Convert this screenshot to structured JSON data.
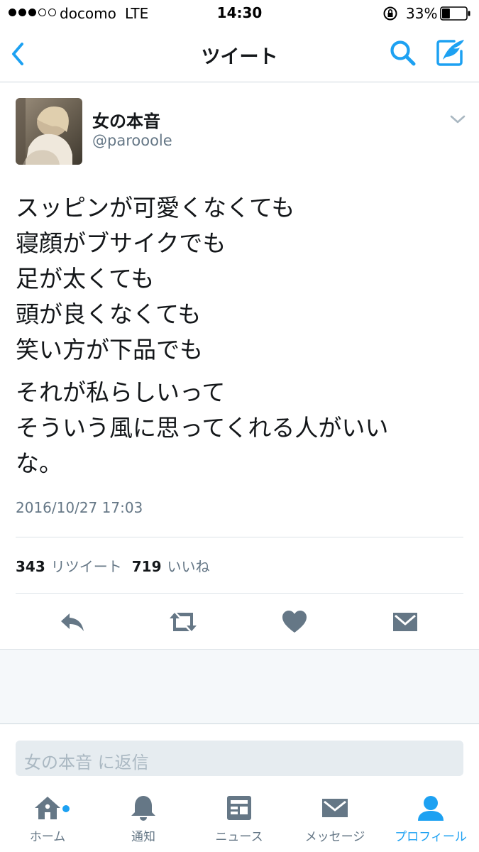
{
  "status_bar": {
    "signal_bars_filled": 3,
    "signal_bars_total": 5,
    "carrier": "docomo",
    "network": "LTE",
    "time": "14:30",
    "battery": "33%",
    "battery_level": 0.33
  },
  "nav": {
    "title": "ツイート",
    "back_icon": "chevron-left-icon",
    "search_icon": "search-icon",
    "compose_icon": "compose-tweet-icon",
    "accent_color": "#1da1f2"
  },
  "tweet": {
    "display_name": "女の本音",
    "handle": "@parooole",
    "paragraphs": [
      [
        "スッピンが可愛くなくても",
        "寝顔がブサイクでも",
        "足が太くても",
        "頭が良くなくても",
        "笑い方が下品でも"
      ],
      [
        "それが私らしいって",
        "そういう風に思ってくれる人がいい",
        "な。"
      ]
    ],
    "timestamp": "2016/10/27 17:03",
    "retweet_count": "343",
    "retweet_label": "リツイート",
    "like_count": "719",
    "like_label": "いいね"
  },
  "actions": [
    "reply-icon",
    "retweet-icon",
    "heart-icon",
    "direct-message-icon"
  ],
  "reply": {
    "placeholder": "女の本音 に返信"
  },
  "tabs": [
    {
      "label": "ホーム",
      "icon": "home-icon",
      "active": false
    },
    {
      "label": "通知",
      "icon": "bell-icon",
      "active": false
    },
    {
      "label": "ニュース",
      "icon": "news-icon",
      "active": false
    },
    {
      "label": "メッセージ",
      "icon": "envelope-icon",
      "active": false
    },
    {
      "label": "プロフィール",
      "icon": "profile-icon",
      "active": true
    }
  ]
}
